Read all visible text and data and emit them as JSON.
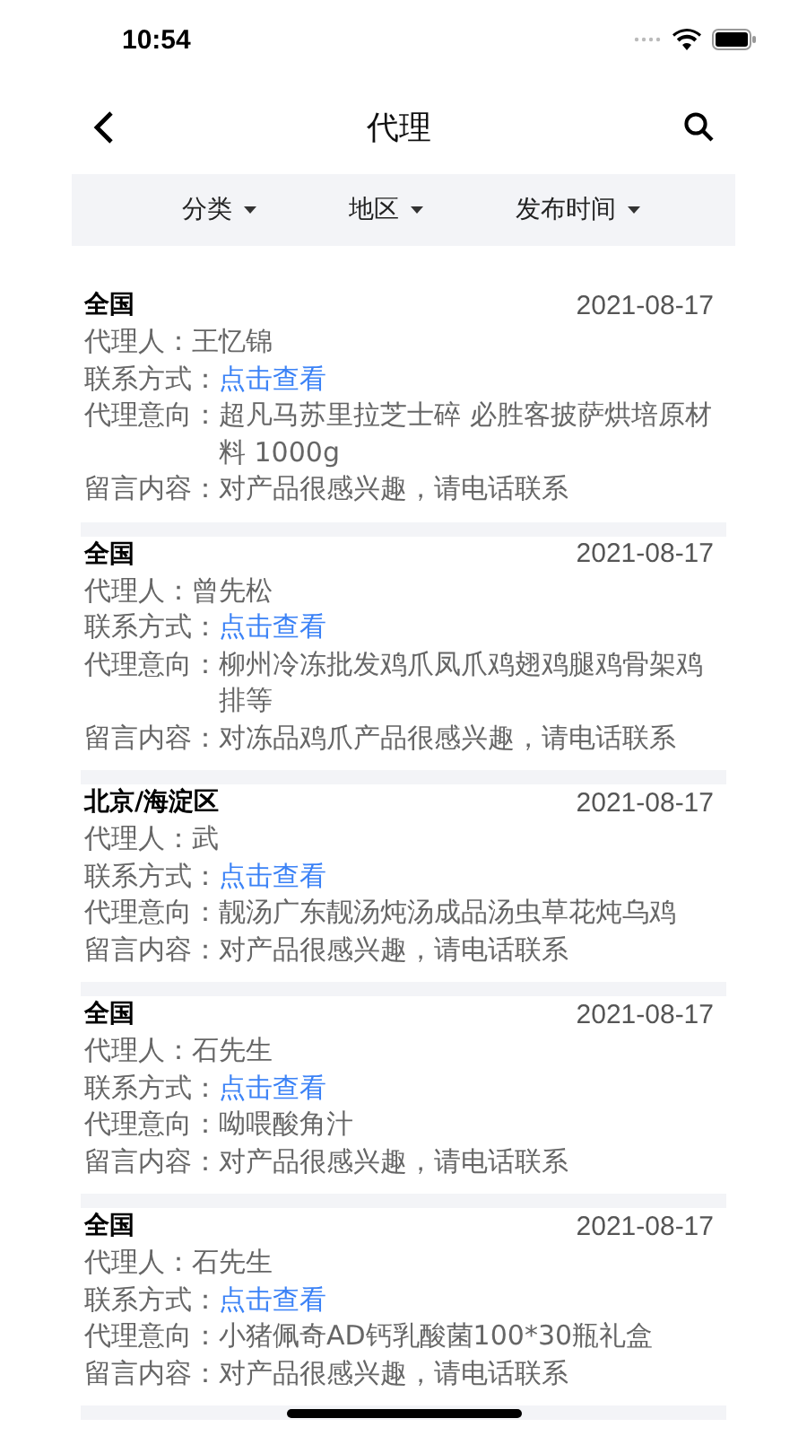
{
  "status_bar": {
    "time": "10:54"
  },
  "nav": {
    "title": "代理"
  },
  "filters": [
    {
      "label": "分类"
    },
    {
      "label": "地区"
    },
    {
      "label": "发布时间"
    }
  ],
  "listings": [
    {
      "region": "全国",
      "date": "2021-08-17",
      "rows": [
        {
          "kind": "text",
          "label": "代理人：",
          "value": "王忆锦"
        },
        {
          "kind": "link",
          "label": "联系方式：",
          "value": "点击查看"
        },
        {
          "kind": "text",
          "label": "代理意向：",
          "value": "超凡马苏里拉芝士碎 必胜客披萨烘培原材料 1000g"
        },
        {
          "kind": "text",
          "label": "留言内容：",
          "value": "对产品很感兴趣，请电话联系"
        }
      ]
    },
    {
      "region": "全国",
      "date": "2021-08-17",
      "rows": [
        {
          "kind": "text",
          "label": "代理人：",
          "value": "曾先松"
        },
        {
          "kind": "link",
          "label": "联系方式：",
          "value": "点击查看"
        },
        {
          "kind": "text",
          "label": "代理意向：",
          "value": "柳州冷冻批发鸡爪凤爪鸡翅鸡腿鸡骨架鸡排等"
        },
        {
          "kind": "text",
          "label": "留言内容：",
          "value": "对冻品鸡爪产品很感兴趣，请电话联系"
        }
      ]
    },
    {
      "region": "北京/海淀区",
      "date": "2021-08-17",
      "rows": [
        {
          "kind": "text",
          "label": "代理人：",
          "value": "武"
        },
        {
          "kind": "link",
          "label": "联系方式：",
          "value": "点击查看"
        },
        {
          "kind": "text",
          "label": "代理意向：",
          "value": "靓汤广东靓汤炖汤成品汤虫草花炖乌鸡"
        },
        {
          "kind": "text",
          "label": "留言内容：",
          "value": "对产品很感兴趣，请电话联系"
        }
      ]
    },
    {
      "region": "全国",
      "date": "2021-08-17",
      "rows": [
        {
          "kind": "text",
          "label": "代理人：",
          "value": "石先生"
        },
        {
          "kind": "link",
          "label": "联系方式：",
          "value": "点击查看"
        },
        {
          "kind": "text",
          "label": "代理意向：",
          "value": "呦喂酸角汁"
        },
        {
          "kind": "text",
          "label": "留言内容：",
          "value": "对产品很感兴趣，请电话联系"
        }
      ]
    },
    {
      "region": "全国",
      "date": "2021-08-17",
      "rows": [
        {
          "kind": "text",
          "label": "代理人：",
          "value": "石先生"
        },
        {
          "kind": "link",
          "label": "联系方式：",
          "value": "点击查看"
        },
        {
          "kind": "text",
          "label": "代理意向：",
          "value": "小猪佩奇AD钙乳酸菌100*30瓶礼盒"
        },
        {
          "kind": "text",
          "label": "留言内容：",
          "value": "对产品很感兴趣，请电话联系"
        }
      ]
    }
  ]
}
